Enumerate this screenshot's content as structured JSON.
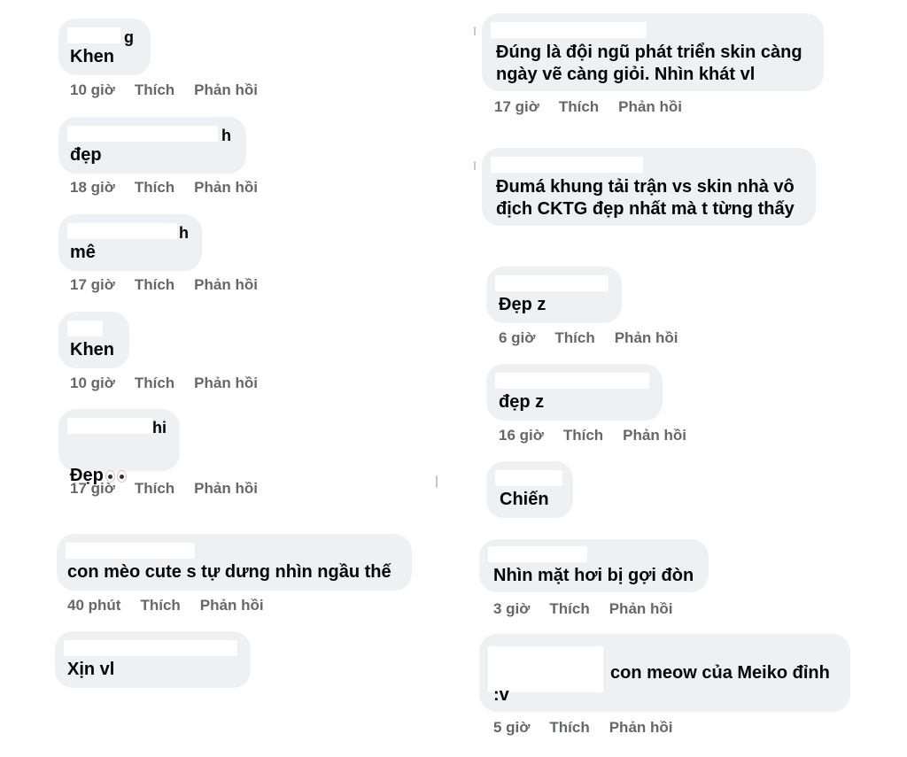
{
  "left_column": [
    {
      "name_visible": "g",
      "text": "Khen",
      "time": "10 giờ",
      "like": "Thích",
      "reply": "Phản hồi"
    },
    {
      "name_visible": "h",
      "text": "đẹp",
      "time": "18 giờ",
      "like": "Thích",
      "reply": "Phản hồi"
    },
    {
      "name_visible": "h",
      "text": "mê",
      "time": "17 giờ",
      "like": "Thích",
      "reply": "Phản hồi"
    },
    {
      "name_visible": "",
      "text": "Khen",
      "time": "10 giờ",
      "like": "Thích",
      "reply": "Phản hồi"
    },
    {
      "name_visible": "hi",
      "text": "Đẹp",
      "time": "17 giờ",
      "like": "Thích",
      "reply": "Phản hồi"
    },
    {
      "name_visible": "",
      "text": "con mèo cute s tự dưng nhìn ngầu thế",
      "time": "40 phút",
      "like": "Thích",
      "reply": "Phản hồi"
    },
    {
      "name_visible": "",
      "text": "Xịn vl",
      "time": "",
      "like": "",
      "reply": ""
    }
  ],
  "right_column": [
    {
      "name_visible": "",
      "text": "Đúng là đội ngũ phát triển skin càng\nngày vẽ càng giỏi. Nhìn khát vl",
      "time": "17 giờ",
      "like": "Thích",
      "reply": "Phản hồi"
    },
    {
      "name_visible": "",
      "text": "Đumá khung tải trận vs skin nhà vô\nđịch CKTG đẹp nhất mà t từng thấy",
      "time": "",
      "like": "",
      "reply": ""
    },
    {
      "name_visible": "",
      "text": "Đẹp z",
      "time": "6 giờ",
      "like": "Thích",
      "reply": "Phản hồi"
    },
    {
      "name_visible": "",
      "text": "đẹp z",
      "time": "16 giờ",
      "like": "Thích",
      "reply": "Phản hồi"
    },
    {
      "name_visible": "",
      "text": "Chiến",
      "time": "",
      "like": "",
      "reply": ""
    },
    {
      "name_visible": "",
      "text": "Nhìn mặt hơi bị gợi đòn",
      "time": "3 giờ",
      "like": "Thích",
      "reply": "Phản hồi"
    },
    {
      "name_visible": "",
      "text": "con meow của Meiko đỉnh\n:v",
      "time": "5 giờ",
      "like": "Thích",
      "reply": "Phản hồi"
    }
  ],
  "colors": {
    "bubble": "#eef0f3",
    "meta_text": "#65676b",
    "text": "#050505"
  },
  "icons": {
    "emoji_after_L4": "eyes-emoji"
  }
}
